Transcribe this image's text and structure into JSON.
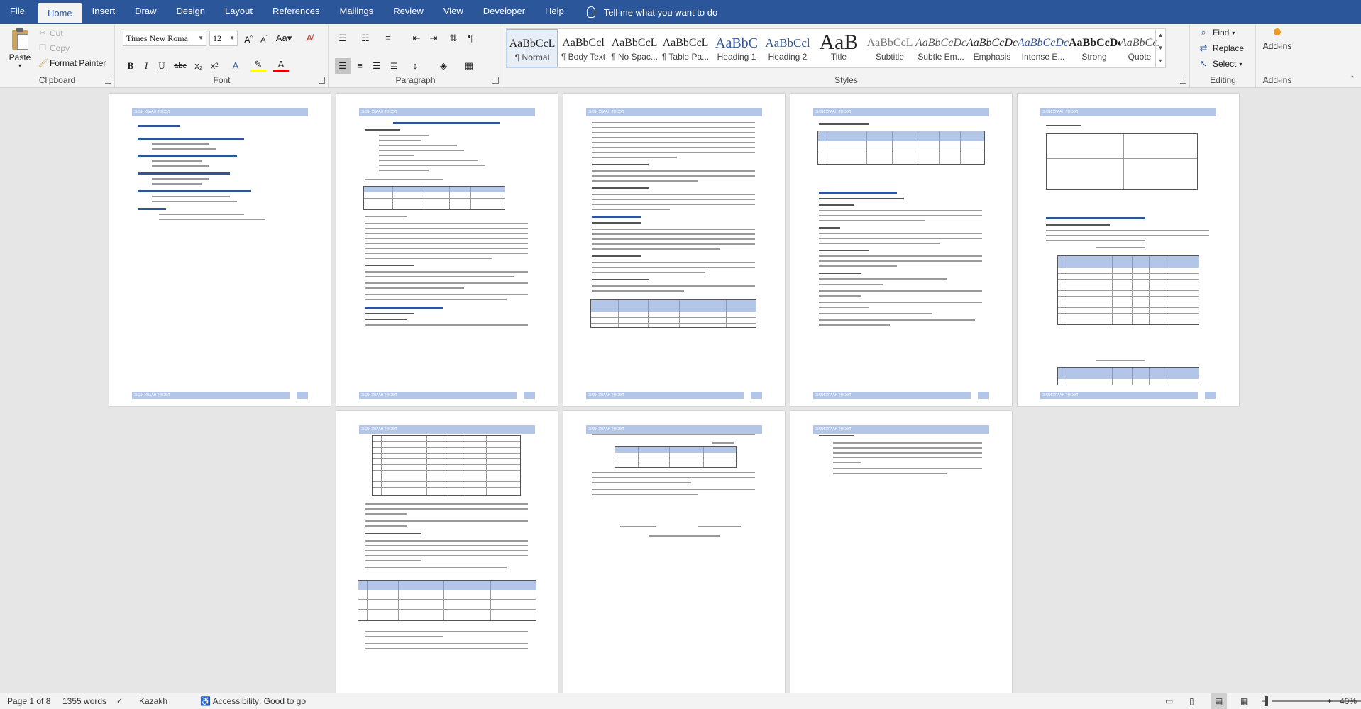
{
  "tabs": [
    "File",
    "Home",
    "Insert",
    "Draw",
    "Design",
    "Layout",
    "References",
    "Mailings",
    "Review",
    "View",
    "Developer",
    "Help"
  ],
  "active_tab": "Home",
  "tell_me": "Tell me what you want to do",
  "clipboard": {
    "paste": "Paste",
    "cut": "Cut",
    "copy": "Copy",
    "format_painter": "Format Painter",
    "label": "Clipboard"
  },
  "font": {
    "name": "Times New Roma",
    "size": "12",
    "label": "Font",
    "bold": "B",
    "italic": "I",
    "underline": "U",
    "strike": "abc",
    "sub": "x₂",
    "sup": "x²",
    "grow": "A^",
    "shrink": "Aˇ",
    "case": "Aa",
    "clear": "A"
  },
  "paragraph": {
    "label": "Paragraph",
    "pilcrow": "¶"
  },
  "styles": {
    "label": "Styles",
    "items": [
      {
        "sample": "AaBbCcL",
        "name": "¶ Normal"
      },
      {
        "sample": "AaBbCcl",
        "name": "¶ Body Text"
      },
      {
        "sample": "AaBbCcL",
        "name": "¶ No Spac..."
      },
      {
        "sample": "AaBbCcL",
        "name": "¶ Table Pa..."
      },
      {
        "sample": "AaBbC",
        "name": "Heading 1"
      },
      {
        "sample": "AaBbCcl",
        "name": "Heading 2"
      },
      {
        "sample": "AaB",
        "name": "Title"
      },
      {
        "sample": "AaBbCcL",
        "name": "Subtitle"
      },
      {
        "sample": "AaBbCcDc",
        "name": "Subtle Em..."
      },
      {
        "sample": "AaBbCcDc",
        "name": "Emphasis"
      },
      {
        "sample": "AaBbCcDc",
        "name": "Intense E..."
      },
      {
        "sample": "AaBbCcDc",
        "name": "Strong"
      },
      {
        "sample": "AaBbCcL",
        "name": "Quote"
      }
    ]
  },
  "editing": {
    "label": "Editing",
    "find": "Find",
    "replace": "Replace",
    "select": "Select"
  },
  "addins": {
    "label": "Add-ins",
    "button": "Add-ins"
  },
  "document": {
    "header_text": "ЗИЗИ УЛААН ТӨСӨЛ"
  },
  "status": {
    "page": "Page 1 of 8",
    "words": "1355 words",
    "language": "Kazakh",
    "accessibility": "Accessibility: Good to go",
    "zoom": "40%",
    "minus": "−",
    "plus": "+"
  }
}
